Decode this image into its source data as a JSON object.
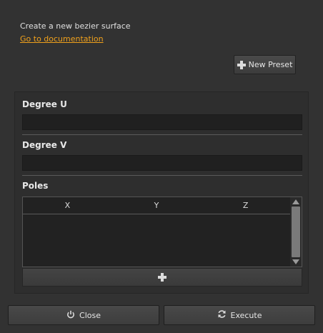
{
  "description": "Create a new bezier surface",
  "doc_link": "Go to documentation",
  "new_preset": {
    "label": "New Preset",
    "icon": "plus-icon"
  },
  "fields": {
    "degree_u": {
      "label": "Degree U",
      "value": ""
    },
    "degree_v": {
      "label": "Degree V",
      "value": ""
    }
  },
  "poles": {
    "label": "Poles",
    "columns": [
      "X",
      "Y",
      "Z"
    ],
    "rows": [],
    "add_icon": "plus-icon"
  },
  "buttons": {
    "close": {
      "label": "Close",
      "icon": "power-icon"
    },
    "execute": {
      "label": "Execute",
      "icon": "refresh-icon"
    }
  },
  "colors": {
    "background": "#323232",
    "link": "#f0a11c",
    "input": "#202020"
  }
}
